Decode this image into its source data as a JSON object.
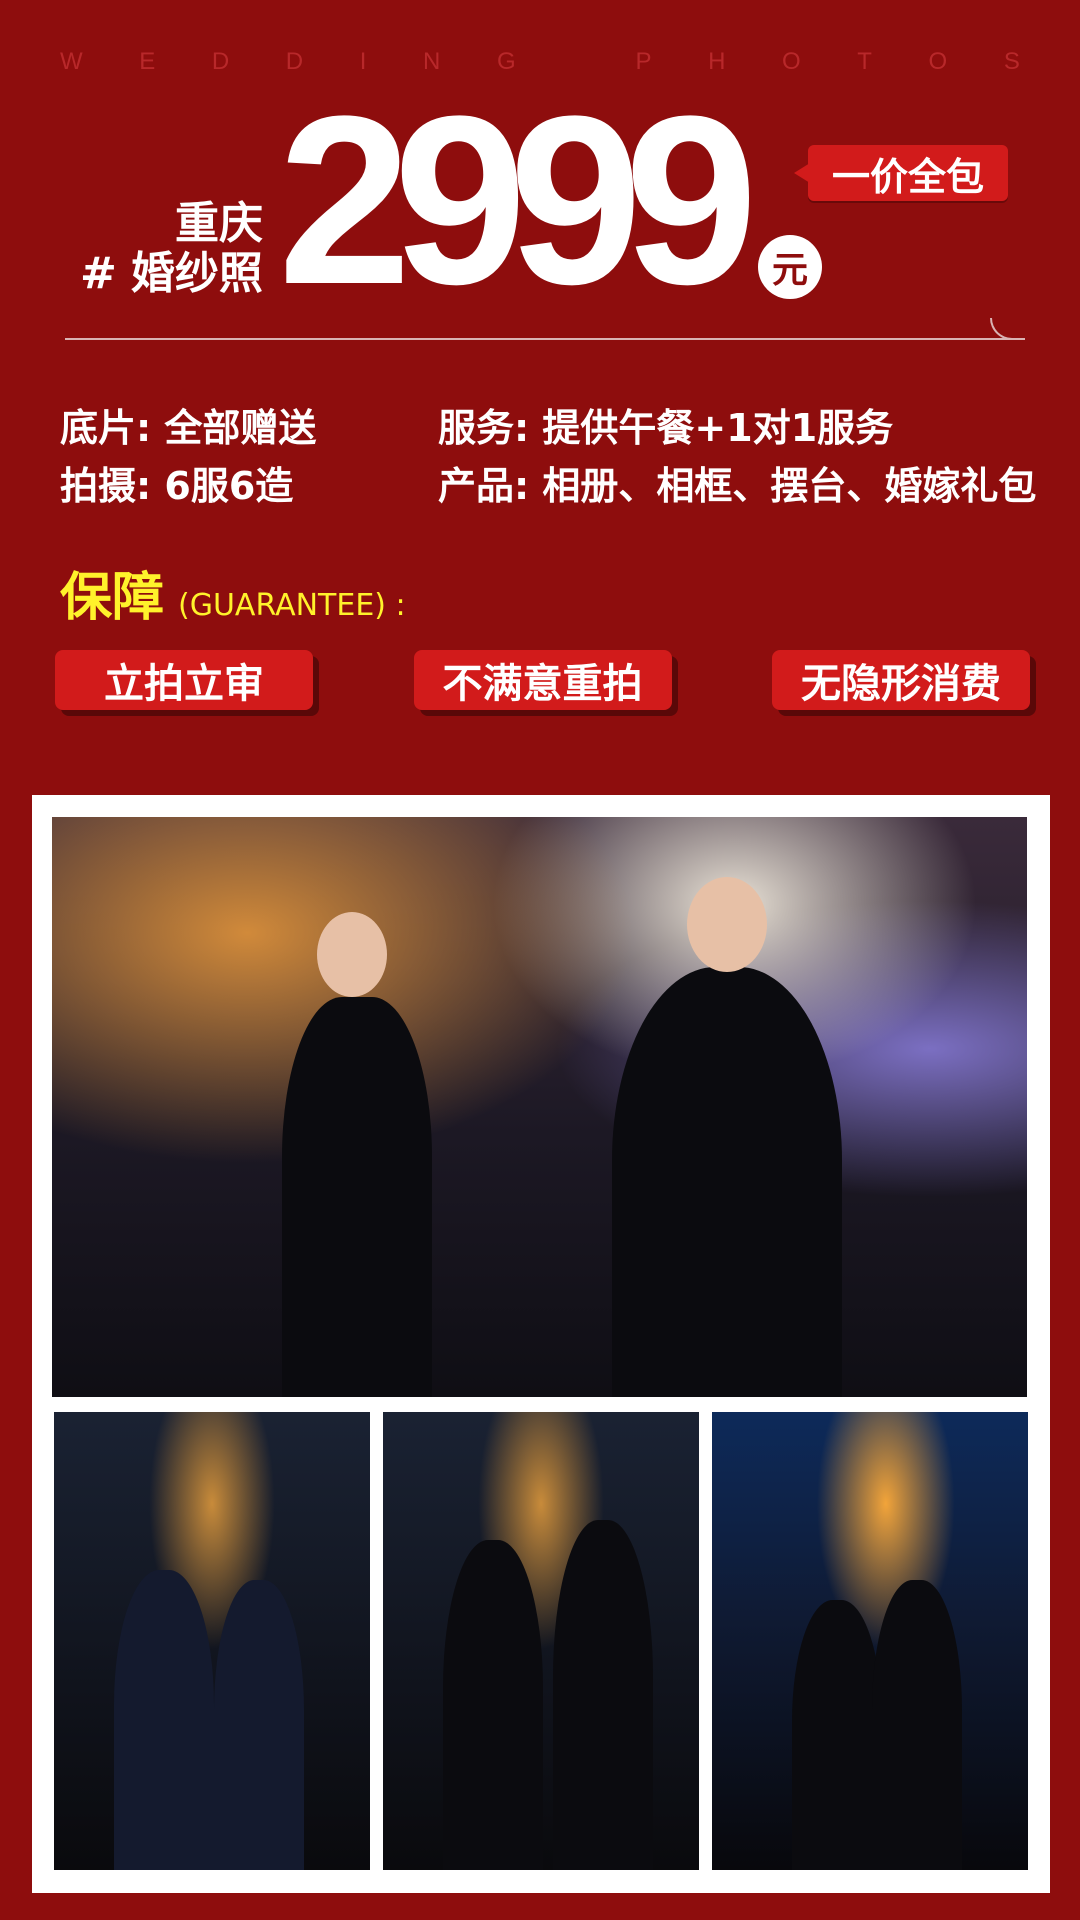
{
  "header": {
    "eyebrow_letters": [
      "W",
      "E",
      "D",
      "D",
      "I",
      "N",
      "G",
      "P",
      "H",
      "O",
      "T",
      "O",
      "S"
    ],
    "city": "重庆",
    "hash": "#",
    "title": "婚纱照",
    "price": "2999",
    "unit": "元",
    "badge": "一价全包"
  },
  "info": {
    "rows": [
      {
        "left": "底片: 全部赠送",
        "right": "服务: 提供午餐+1对1服务"
      },
      {
        "left": "拍摄: 6服6造",
        "right": "产品: 相册、相框、摆台、婚嫁礼包"
      }
    ]
  },
  "guarantee": {
    "title": "保障",
    "subtitle": "(GUARANTEE) :",
    "chips": [
      "立拍立审",
      "不满意重拍",
      "无隐形消费"
    ]
  },
  "colors": {
    "bg": "#8e0d0d",
    "accent": "#d21b1b",
    "yellow": "#fff22b"
  }
}
